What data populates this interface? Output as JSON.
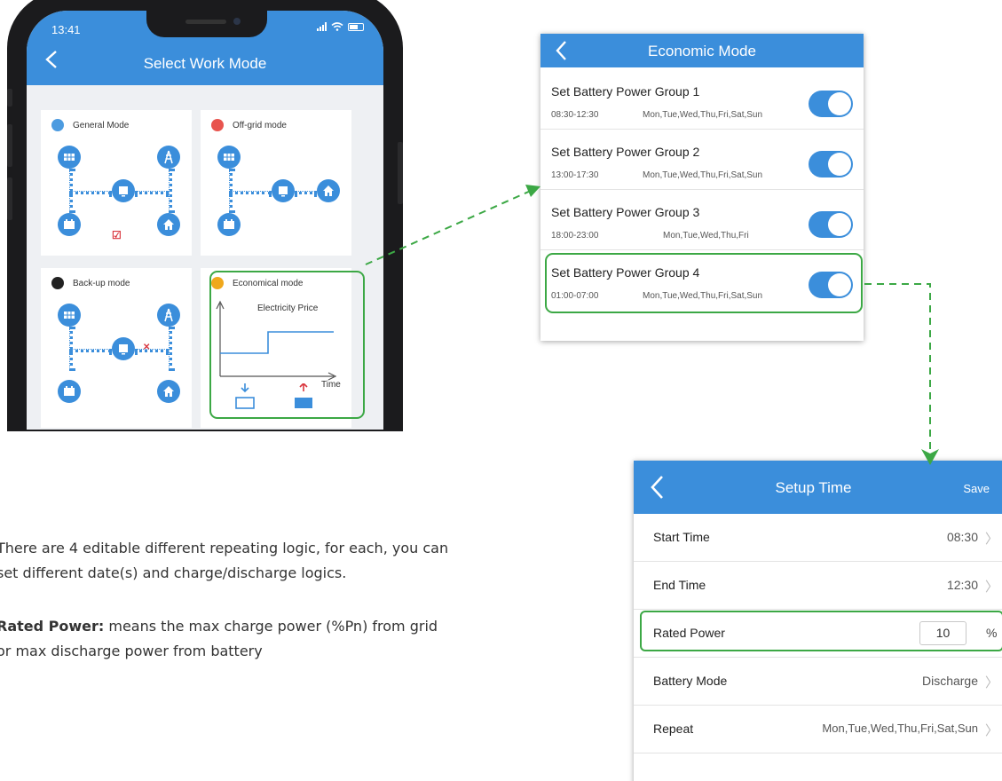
{
  "phone": {
    "status_time": "13:41",
    "title": "Select Work Mode",
    "modes": [
      {
        "name": "General Mode"
      },
      {
        "name": "Off-grid mode"
      },
      {
        "name": "Back-up mode"
      },
      {
        "name": "Economical mode",
        "chart_label": "Electricity Price",
        "axis_label": "Time"
      }
    ]
  },
  "economic_mode": {
    "title": "Economic Mode",
    "groups": [
      {
        "title": "Set Battery Power Group 1",
        "time": "08:30-12:30",
        "days": "Mon,Tue,Wed,Thu,Fri,Sat,Sun",
        "enabled": true
      },
      {
        "title": "Set Battery Power Group 2",
        "time": "13:00-17:30",
        "days": "Mon,Tue,Wed,Thu,Fri,Sat,Sun",
        "enabled": true
      },
      {
        "title": "Set Battery Power Group 3",
        "time": "18:00-23:00",
        "days": "Mon,Tue,Wed,Thu,Fri",
        "enabled": true
      },
      {
        "title": "Set Battery Power Group 4",
        "time": "01:00-07:00",
        "days": "Mon,Tue,Wed,Thu,Fri,Sat,Sun",
        "enabled": true
      }
    ]
  },
  "setup_time": {
    "title": "Setup Time",
    "save_label": "Save",
    "rows": {
      "start_time": {
        "label": "Start Time",
        "value": "08:30"
      },
      "end_time": {
        "label": "End Time",
        "value": "12:30"
      },
      "rated_power": {
        "label": "Rated Power",
        "value": "10",
        "unit": "%"
      },
      "battery_mode": {
        "label": "Battery Mode",
        "value": "Discharge"
      },
      "repeat": {
        "label": "Repeat",
        "value": "Mon,Tue,Wed,Thu,Fri,Sat,Sun"
      }
    }
  },
  "description": {
    "line1": "There are 4 editable different repeating logic, for each, you can",
    "line2": "set different date(s) and charge/discharge logics.",
    "rated_bold": "Rated Power:",
    "rated_rest": " means the max charge power (%Pn) from grid",
    "rated_line2": "or max discharge power from battery"
  },
  "colors": {
    "accent": "#3b8edb",
    "highlight": "#3ca845",
    "alert": "#d9363e"
  }
}
